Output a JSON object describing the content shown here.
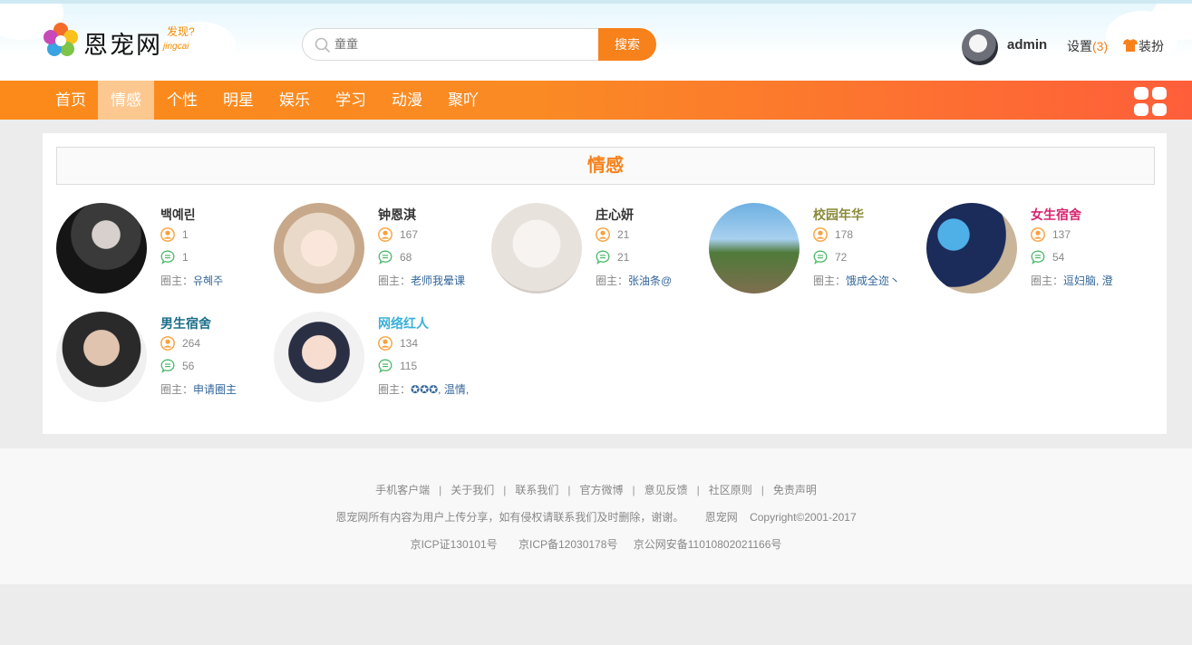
{
  "header": {
    "logo_text": "恩宠网",
    "logo_slogan": "发现?",
    "logo_slogan_sub": "jingcai",
    "search_placeholder": "童童",
    "search_button": "搜索",
    "username": "admin",
    "settings_label": "设置",
    "settings_count": "(3)",
    "dress_label": "装扮"
  },
  "nav": {
    "items": [
      "首页",
      "情感",
      "个性",
      "明星",
      "娱乐",
      "学习",
      "动漫",
      "聚吖"
    ],
    "active": "情感"
  },
  "section": {
    "title": "情感",
    "owner_prefix": "圈主：",
    "cards": [
      {
        "name": "백예린",
        "name_color": "#333333",
        "members": "1",
        "posts": "1",
        "owner": "유혜주"
      },
      {
        "name": "钟恩淇",
        "name_color": "#333333",
        "members": "167",
        "posts": "68",
        "owner": "老师我晕课"
      },
      {
        "name": "庄心妍",
        "name_color": "#333333",
        "members": "21",
        "posts": "21",
        "owner": "张油条@"
      },
      {
        "name": "校园年华",
        "name_color": "#8a8a3a",
        "members": "178",
        "posts": "72",
        "owner": "饿成全迩丶"
      },
      {
        "name": "女生宿舍",
        "name_color": "#d6246e",
        "members": "137",
        "posts": "54",
        "owner": "逗妇脑, 澄"
      },
      {
        "name": "男生宿舍",
        "name_color": "#1a6e8a",
        "members": "264",
        "posts": "56",
        "owner": "申请圈主"
      },
      {
        "name": "网络红人",
        "name_color": "#3ab0d8",
        "members": "134",
        "posts": "115",
        "owner": "✪✪✪, 温情,"
      }
    ]
  },
  "icons": {
    "member": "user-icon",
    "post": "comment-icon",
    "accent": "#f7811b",
    "member_color": "#f7a23c",
    "post_color": "#4cb86a"
  },
  "footer": {
    "links": [
      "手机客户端",
      "关于我们",
      "联系我们",
      "官方微博",
      "意见反馈",
      "社区原则",
      "免责声明"
    ],
    "separator": "|",
    "notice": "恩宠网所有内容为用户上传分享，如有侵权请联系我们及时删除，谢谢。",
    "brand": "恩宠网",
    "copyright": "Copyright©2001-2017",
    "icp1": "京ICP证130101号",
    "icp2": "京ICP备12030178号",
    "icp3": "京公网安备11010802021166号"
  }
}
